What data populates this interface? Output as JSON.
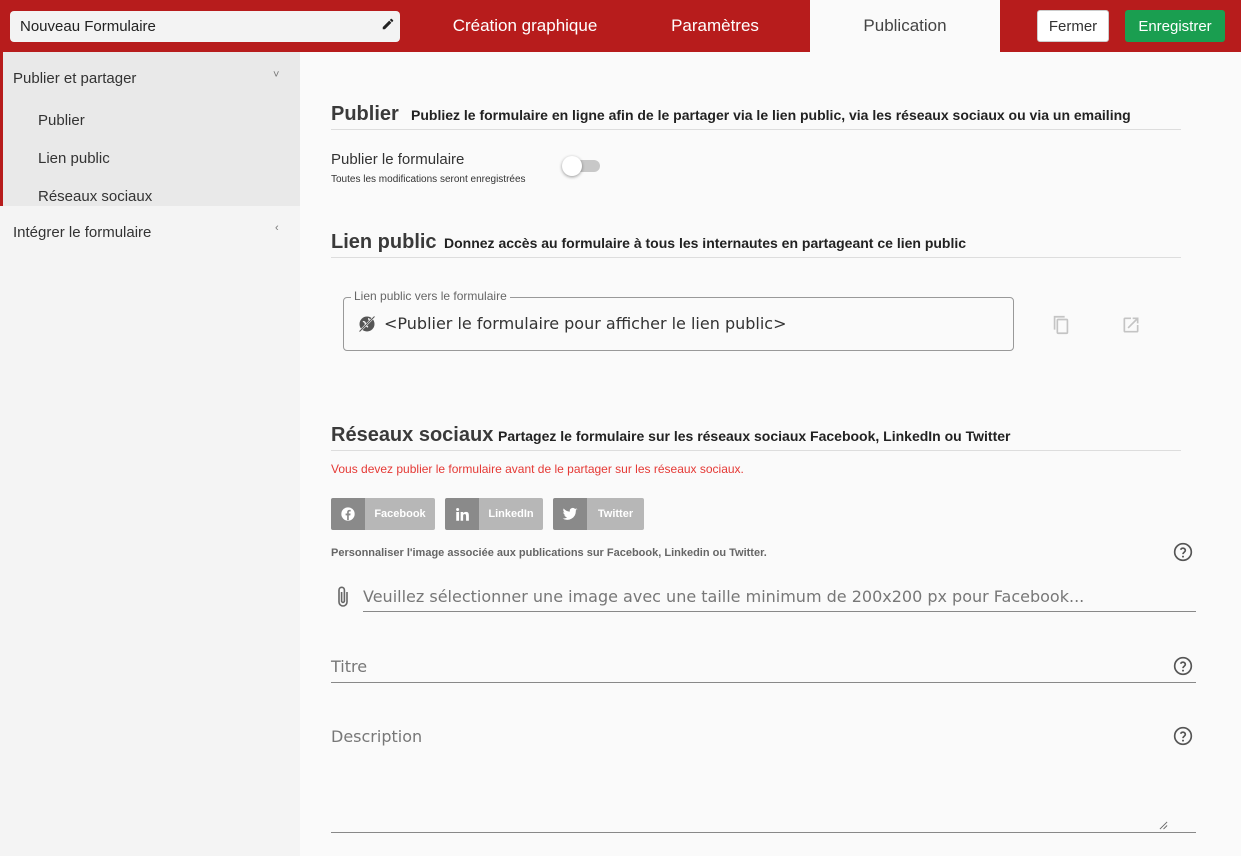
{
  "header": {
    "form_title": "Nouveau Formulaire",
    "tabs": [
      {
        "label": "Création graphique"
      },
      {
        "label": "Paramètres"
      },
      {
        "label": "Publication"
      }
    ],
    "close_label": "Fermer",
    "save_label": "Enregistrer"
  },
  "sidebar": {
    "group_label": "Publier et partager",
    "items": [
      {
        "label": "Publier"
      },
      {
        "label": "Lien public"
      },
      {
        "label": "Réseaux sociaux"
      }
    ],
    "integrate_label": "Intégrer le formulaire"
  },
  "publish": {
    "heading": "Publier",
    "subtitle": "Publiez le formulaire en ligne afin de le partager via le lien public, via les réseaux sociaux ou via un emailing",
    "toggle_label": "Publier le formulaire",
    "toggle_hint": "Toutes les modifications seront enregistrées",
    "toggle_on": false
  },
  "public_link": {
    "heading": "Lien public",
    "subtitle": "Donnez accès au formulaire à tous les internautes en partageant ce lien public",
    "field_label": "Lien public vers le formulaire",
    "field_value": "<Publier le formulaire pour afficher le lien public>"
  },
  "social": {
    "heading": "Réseaux sociaux",
    "subtitle": "Partagez le formulaire sur les réseaux sociaux Facebook, LinkedIn ou Twitter",
    "warning": "Vous devez publier le formulaire avant de le partager sur les réseaux sociaux.",
    "buttons": [
      {
        "label": "Facebook",
        "icon": "facebook-icon"
      },
      {
        "label": "LinkedIn",
        "icon": "linkedin-icon"
      },
      {
        "label": "Twitter",
        "icon": "twitter-icon"
      }
    ],
    "image_note": "Personnaliser l'image associée aux publications sur Facebook, Linkedin ou Twitter.",
    "image_placeholder": "Veuillez sélectionner une image avec une taille minimum de 200x200 px pour Facebook...",
    "title_placeholder": "Titre",
    "description_placeholder": "Description"
  },
  "colors": {
    "brand_red": "#b71c1c",
    "save_green": "#1a9e50",
    "warning_red": "#e53935"
  }
}
